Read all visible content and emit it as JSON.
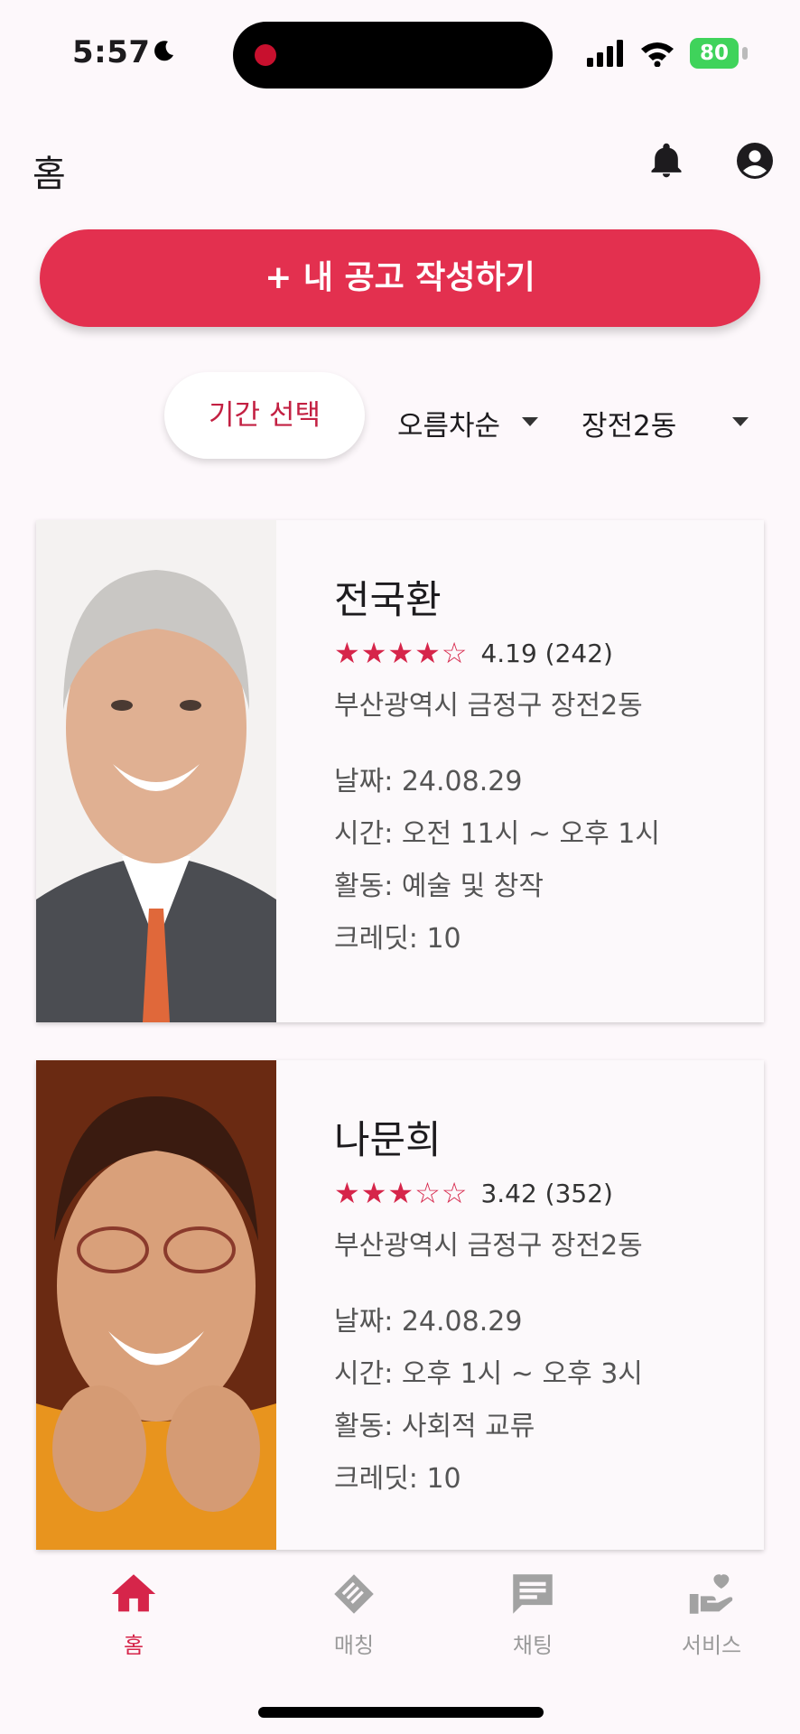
{
  "status_bar": {
    "time": "5:57",
    "battery": "80"
  },
  "header": {
    "title": "홈"
  },
  "cta": {
    "label": "+ 내 공고 작성하기"
  },
  "filters": {
    "period": "기간 선택",
    "sort": "오름차순",
    "region": "장전2동"
  },
  "cards": [
    {
      "name": "전국환",
      "stars": "★★★★☆",
      "rating": "4.19 (242)",
      "location": "부산광역시 금정구 장전2동",
      "date": "날짜: 24.08.29",
      "time": "시간: 오전 11시 ~ 오후 1시",
      "activity": "활동: 예술 및 창작",
      "credit": "크레딧: 10"
    },
    {
      "name": "나문희",
      "stars": "★★★☆☆",
      "rating": "3.42 (352)",
      "location": "부산광역시 금정구 장전2동",
      "date": "날짜: 24.08.29",
      "time": "시간: 오후 1시 ~ 오후 3시",
      "activity": "활동: 사회적 교류",
      "credit": "크레딧: 10"
    }
  ],
  "nav": [
    {
      "label": "홈",
      "icon": "home-icon"
    },
    {
      "label": "매칭",
      "icon": "handshake-icon"
    },
    {
      "label": "채팅",
      "icon": "chat-icon"
    },
    {
      "label": "서비스",
      "icon": "care-hand-heart-icon"
    }
  ],
  "colors": {
    "accent": "#e3304f",
    "star": "#d6254a",
    "background": "#fdf8fb"
  }
}
